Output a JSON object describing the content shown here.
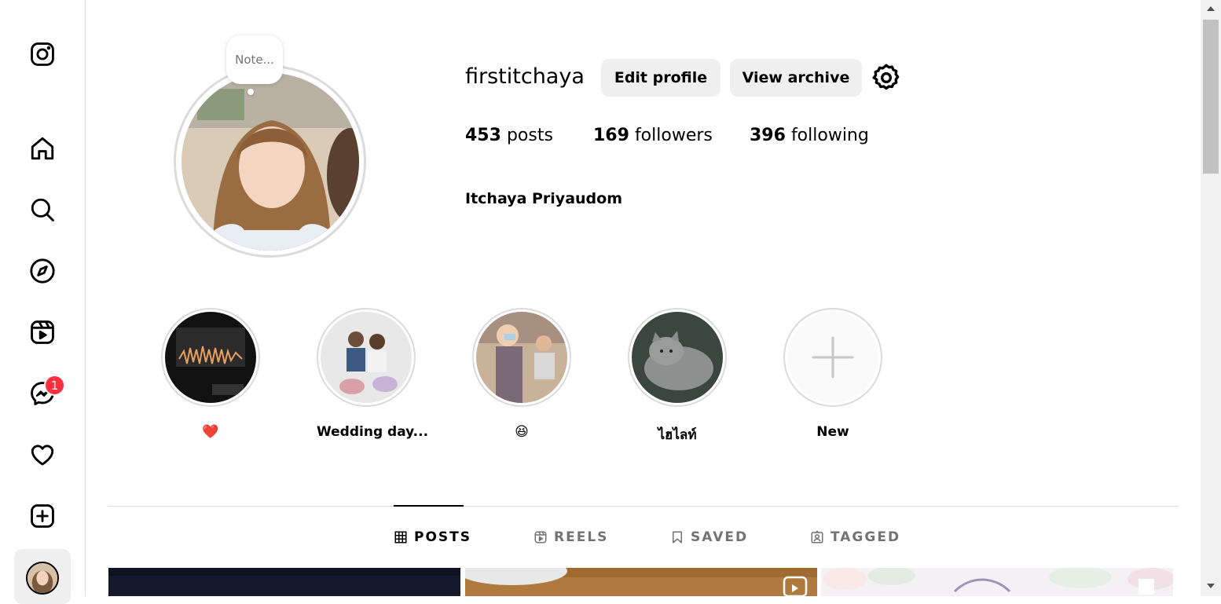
{
  "app": {
    "name": "Instagram"
  },
  "sidebar": {
    "items": [
      {
        "name": "home",
        "label": "Home"
      },
      {
        "name": "search",
        "label": "Search"
      },
      {
        "name": "explore",
        "label": "Explore"
      },
      {
        "name": "reels",
        "label": "Reels"
      },
      {
        "name": "messages",
        "label": "Messages"
      },
      {
        "name": "notifications",
        "label": "Notifications"
      },
      {
        "name": "create",
        "label": "Create"
      },
      {
        "name": "profile",
        "label": "Profile"
      }
    ],
    "messages_badge": "1"
  },
  "profile": {
    "note_placeholder": "Note...",
    "username": "firstitchaya",
    "edit_profile_label": "Edit profile",
    "view_archive_label": "View archive",
    "posts_count": "453",
    "posts_label": "posts",
    "followers_count": "169",
    "followers_label": "followers",
    "following_count": "396",
    "following_label": "following",
    "full_name": "Itchaya Priyaudom"
  },
  "highlights": [
    {
      "label": "❤️"
    },
    {
      "label": "Wedding day..."
    },
    {
      "label": "😆"
    },
    {
      "label": "ไฮไลท์"
    },
    {
      "label": "New"
    }
  ],
  "tabs": [
    {
      "label": "POSTS",
      "active": true
    },
    {
      "label": "REELS",
      "active": false
    },
    {
      "label": "SAVED",
      "active": false
    },
    {
      "label": "TAGGED",
      "active": false
    }
  ],
  "colors": {
    "badge": "#ff3040",
    "button_bg": "#efefef",
    "border": "#dbdbdb",
    "muted": "#737373"
  }
}
